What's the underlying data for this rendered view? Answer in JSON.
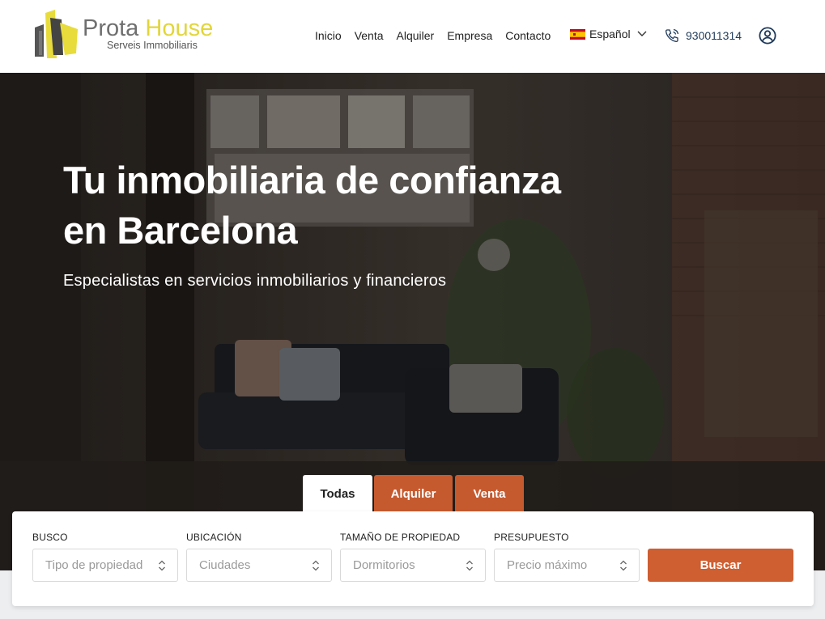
{
  "brand": {
    "name_part1": "Prota",
    "name_part2": "House",
    "tagline": "Serveis Immobiliaris"
  },
  "nav": {
    "items": [
      {
        "label": "Inicio"
      },
      {
        "label": "Venta"
      },
      {
        "label": "Alquiler"
      },
      {
        "label": "Empresa"
      },
      {
        "label": "Contacto"
      }
    ],
    "language": {
      "label": "Español",
      "flag": "spain-flag-icon"
    },
    "phone": "930011314",
    "user_icon": "user-account-icon"
  },
  "hero": {
    "title": "Tu inmobiliaria de confianza en Barcelona",
    "subtitle": "Especialistas en servicios inmobiliarios y financieros"
  },
  "tabs": [
    {
      "label": "Todas",
      "active": true
    },
    {
      "label": "Alquiler",
      "active": false
    },
    {
      "label": "Venta",
      "active": false
    }
  ],
  "search": {
    "fields": [
      {
        "label": "BUSCO",
        "placeholder": "Tipo de propiedad"
      },
      {
        "label": "UBICACIÓN",
        "placeholder": "Ciudades"
      },
      {
        "label": "TAMAÑO DE PROPIEDAD",
        "placeholder": "Dormitorios"
      },
      {
        "label": "PRESUPUESTO",
        "placeholder": "Precio máximo"
      }
    ],
    "button_label": "Buscar"
  },
  "colors": {
    "accent": "#cf5e31",
    "brand_yellow": "#e2d63a",
    "phone_text": "#1f3a5a"
  }
}
